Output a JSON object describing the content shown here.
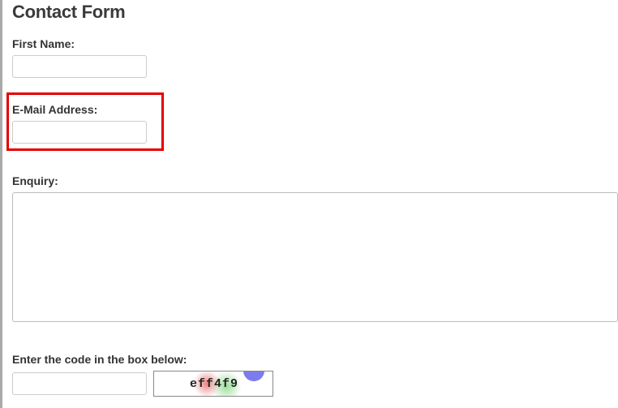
{
  "header": {
    "title": "Contact Form"
  },
  "form": {
    "first_name_label": "First Name:",
    "first_name_value": "",
    "email_label": "E-Mail Address:",
    "email_value": "",
    "enquiry_label": "Enquiry:",
    "enquiry_value": "",
    "captcha_label": "Enter the code in the box below:",
    "captcha_value": "",
    "captcha_code": "eff4f9"
  }
}
